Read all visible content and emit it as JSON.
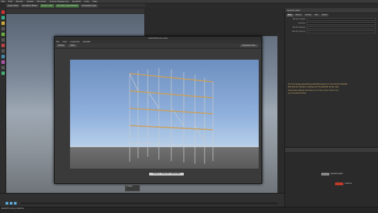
{
  "menubar": {
    "items": [
      "File",
      "Edit",
      "Render",
      "Assets",
      "Windows",
      "Solaris Megascans",
      "Redshift",
      "Labs",
      "Help"
    ]
  },
  "tabs": [
    {
      "label": "Scene View",
      "color": "#444444"
    },
    {
      "label": "Animation Editor",
      "color": "#444444"
    },
    {
      "label": "Render View",
      "color": "#3f6e3a"
    },
    {
      "label": "Geometry Spreadsheet",
      "color": "#3f6e3a"
    },
    {
      "label": "Composite View",
      "color": "#444444"
    }
  ],
  "params": {
    "title": "Redshift_ROP1",
    "tabs": [
      "Main",
      "Objects",
      "Globals",
      "AOV",
      "Output"
    ],
    "fields": [
      "Render Target",
      "Camera",
      "Render Range",
      "Render Device"
    ],
    "info": [
      "The final image generated by Redshift depends on the Houdini Redshift",
      "ROP (Render Operator) settings and the Redshift render view.",
      "Using these settings will allow you to have more control over",
      "your rendered frames."
    ]
  },
  "floating_window": {
    "title": "Redshift Render View",
    "menu": [
      "File",
      "View",
      "Customize",
      "Redshift"
    ],
    "toolbar": [
      "Beauty",
      "Stack",
      "Progressive Ren."
    ],
    "caption": "Frame 1 - 00:00:38 - 1920x1080"
  },
  "stats": {
    "value": "1.03fps"
  },
  "status": {
    "text": "Redshift tracking: Realtime"
  },
  "netview": {
    "nodes": [
      "Redshift_ROP1",
      "mantra1"
    ]
  },
  "colors": {
    "accent_green": "#3f6e3a",
    "node_red": "#c0392b"
  }
}
